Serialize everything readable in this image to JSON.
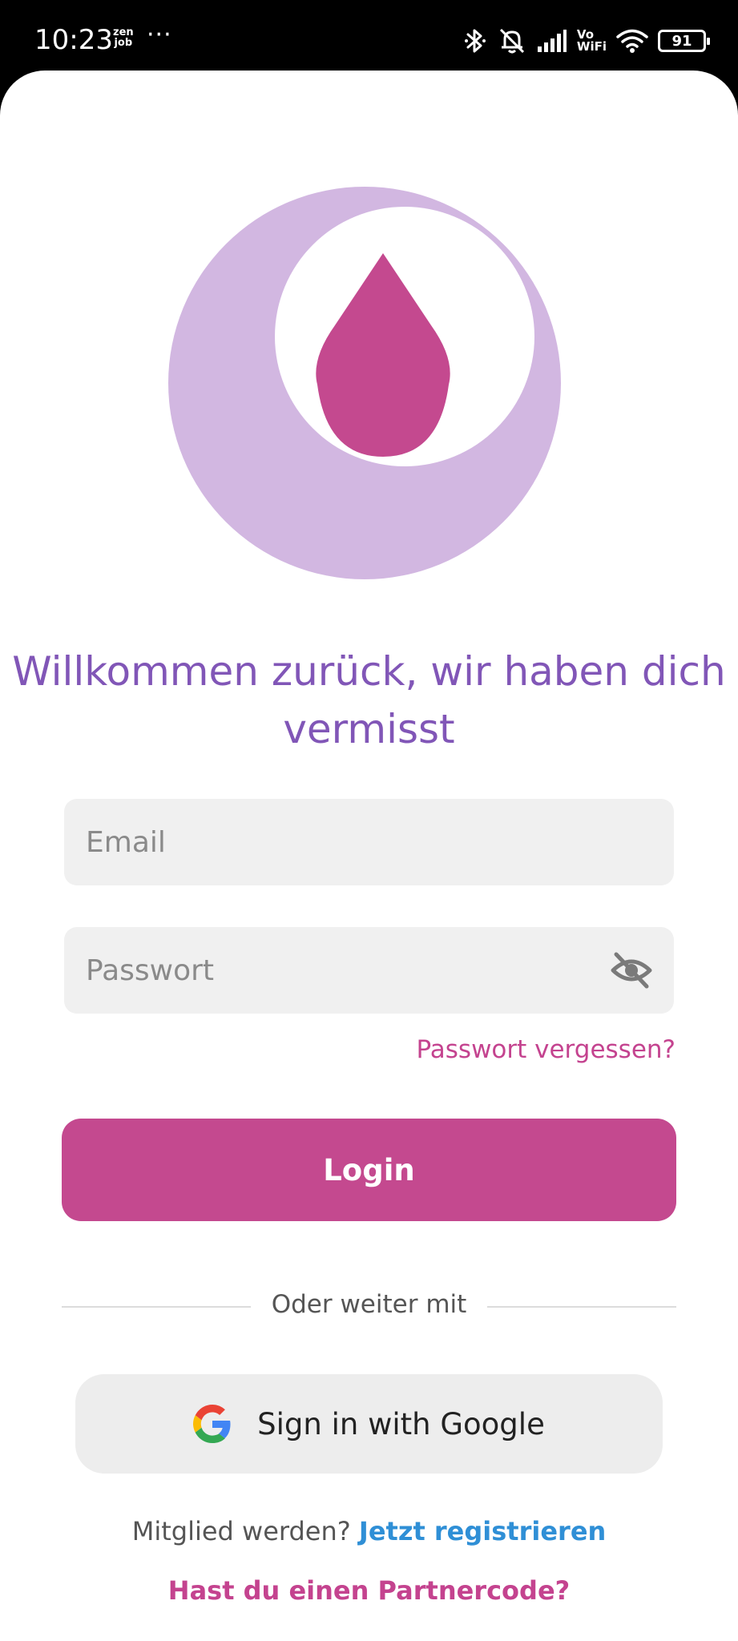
{
  "status_bar": {
    "time": "10:23",
    "app_badge_line1": "zen",
    "app_badge_line2": "job",
    "more_dots": "···",
    "vowifi_line1": "Vo",
    "vowifi_line2": "WiFi",
    "battery_level": "91"
  },
  "login": {
    "title": "Willkommen zurück, wir haben dich vermisst",
    "email_placeholder": "Email",
    "password_placeholder": "Passwort",
    "forgot_password": "Passwort vergessen?",
    "login_button": "Login",
    "divider_text": "Oder weiter mit",
    "google_button": "Sign in with Google",
    "register_prompt": "Mitglied werden?",
    "register_link": "Jetzt registrieren",
    "partner_code_link": "Hast du einen Partnercode?"
  },
  "icons": {
    "logo": "moon-drop-logo-icon",
    "password_visibility": "eye-off-icon",
    "google": "google-g-icon"
  },
  "colors": {
    "title": "#8156b7",
    "primary": "#c4498f",
    "link_blue": "#2f8fd6",
    "moon": "#d2b7e1",
    "drop": "#c4498f"
  }
}
